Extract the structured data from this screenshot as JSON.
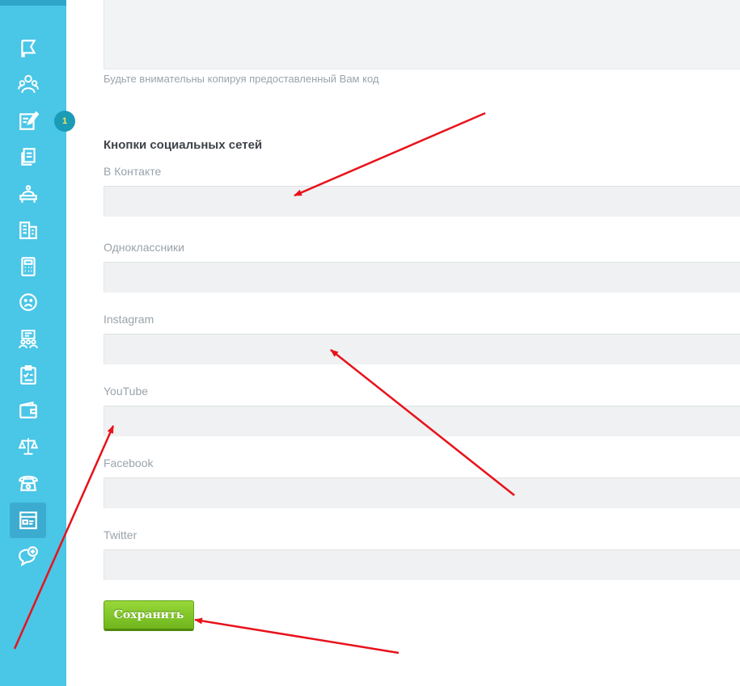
{
  "code_section": {
    "hint": "Будьте внимательны копируя предоставленный Вам код"
  },
  "social": {
    "title": "Кнопки социальных сетей",
    "fields": [
      {
        "label": "В Контакте",
        "value": ""
      },
      {
        "label": "Одноклассники",
        "value": ""
      },
      {
        "label": "Instagram",
        "value": ""
      },
      {
        "label": "YouTube",
        "value": ""
      },
      {
        "label": "Facebook",
        "value": ""
      },
      {
        "label": "Twitter",
        "value": ""
      }
    ]
  },
  "save_label": "Сохранить",
  "badge_count": "1",
  "sidebar": {
    "items": [
      {
        "icon": "flag-icon"
      },
      {
        "icon": "users-group-icon"
      },
      {
        "icon": "edit-note-icon"
      },
      {
        "icon": "documents-icon"
      },
      {
        "icon": "reception-desk-icon"
      },
      {
        "icon": "building-icon"
      },
      {
        "icon": "calculator-icon"
      },
      {
        "icon": "sad-face-icon"
      },
      {
        "icon": "presentation-icon"
      },
      {
        "icon": "checklist-icon"
      },
      {
        "icon": "wallet-icon"
      },
      {
        "icon": "scales-icon"
      },
      {
        "icon": "phone-icon"
      },
      {
        "icon": "browser-window-icon",
        "active": true
      },
      {
        "icon": "chat-add-icon"
      }
    ]
  },
  "colors": {
    "sidebar": "#4ac6e7",
    "badge": "#1a9bb6",
    "button": "#7cc425",
    "annotation_arrow": "#e8121a"
  }
}
